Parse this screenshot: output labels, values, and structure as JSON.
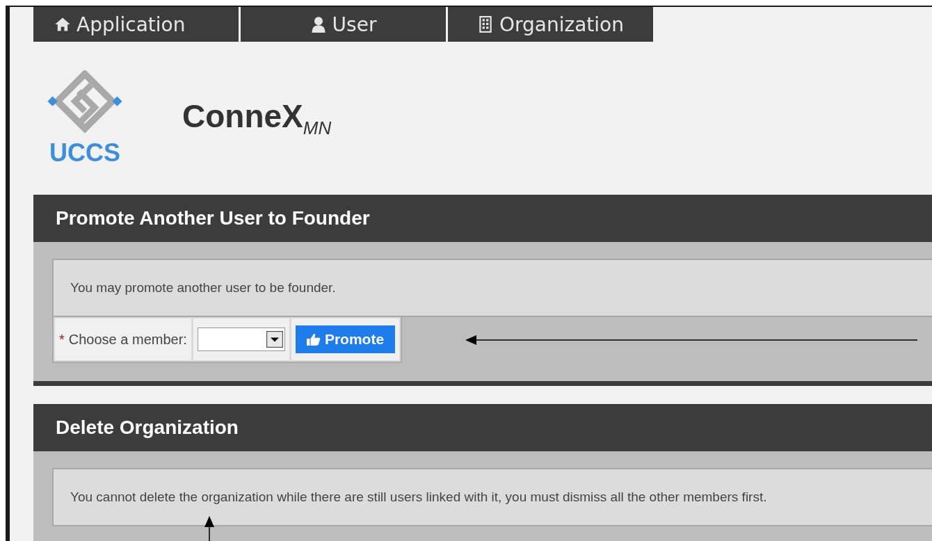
{
  "tabs": [
    {
      "label": "Application",
      "selected": false
    },
    {
      "label": "User",
      "selected": false
    },
    {
      "label": "Organization",
      "selected": false
    }
  ],
  "logo": {
    "text": "UCCS"
  },
  "app_title": "ConneX$_{MN}$",
  "sections": [
    {
      "title": "Promote Another User to Founder",
      "message": "You may promote another user to be founder.",
      "form": {
        "required_mark": "*",
        "label": "Choose a member:",
        "button": "Promote"
      }
    },
    {
      "title": "Delete Organization",
      "message": "You cannot delete the organization while there are still users linked with it, you must dismiss all the other members first."
    }
  ]
}
